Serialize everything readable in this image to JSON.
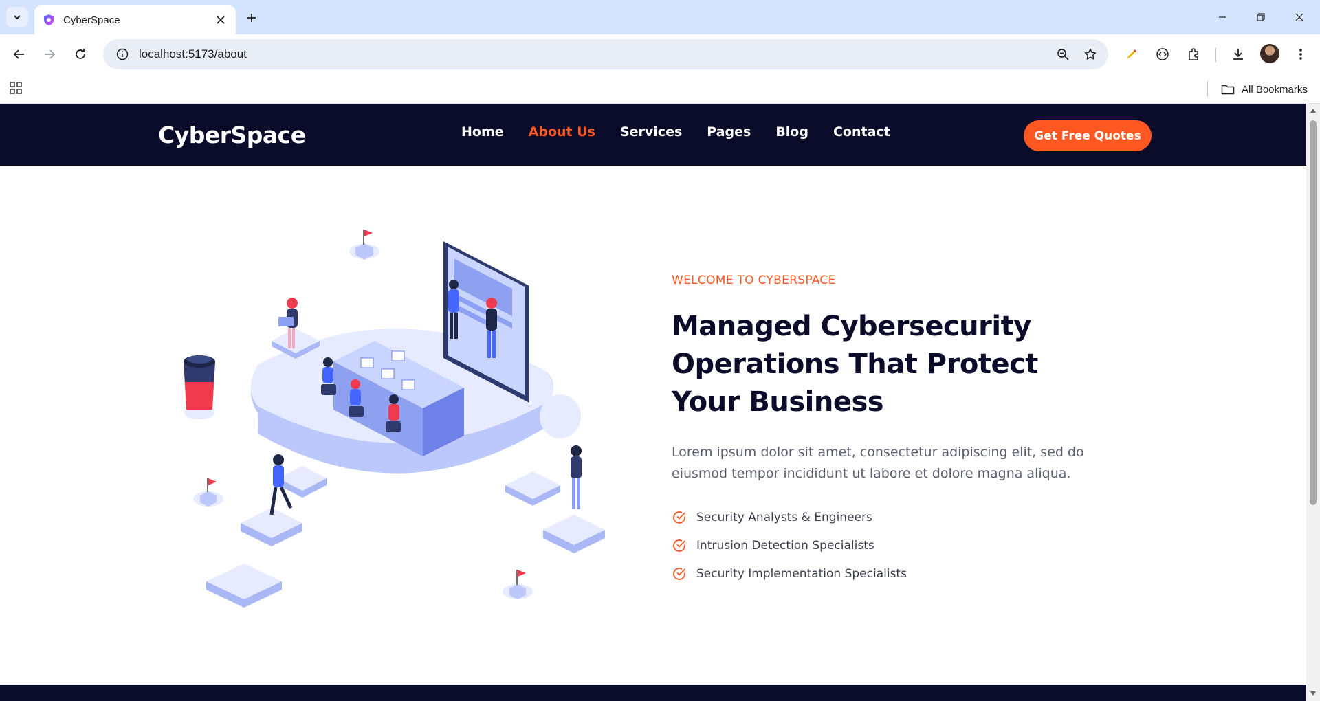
{
  "browser": {
    "tab_title": "CyberSpace",
    "url": "localhost:5173/about",
    "all_bookmarks_label": "All Bookmarks"
  },
  "site": {
    "logo": "CyberSpace",
    "nav": [
      {
        "label": "Home",
        "active": false
      },
      {
        "label": "About Us",
        "active": true
      },
      {
        "label": "Services",
        "active": false
      },
      {
        "label": "Pages",
        "active": false
      },
      {
        "label": "Blog",
        "active": false
      },
      {
        "label": "Contact",
        "active": false
      }
    ],
    "cta_label": "Get Free Quotes",
    "colors": {
      "navy": "#0b0b2a",
      "accent": "#ff5722",
      "illustration": "#a9b7f5"
    }
  },
  "hero": {
    "eyebrow": "WELCOME TO CYBERSPACE",
    "headline_lines": [
      "Managed Cybersecurity",
      "Operations That Protect",
      "Your Business"
    ],
    "lead": "Lorem ipsum dolor sit amet, consectetur adipiscing elit, sed do eiusmod tempor incididunt ut labore et dolore magna aliqua.",
    "features": [
      "Security Analysts & Engineers",
      "Intrusion Detection Specialists",
      "Security Implementation Specialists"
    ]
  }
}
